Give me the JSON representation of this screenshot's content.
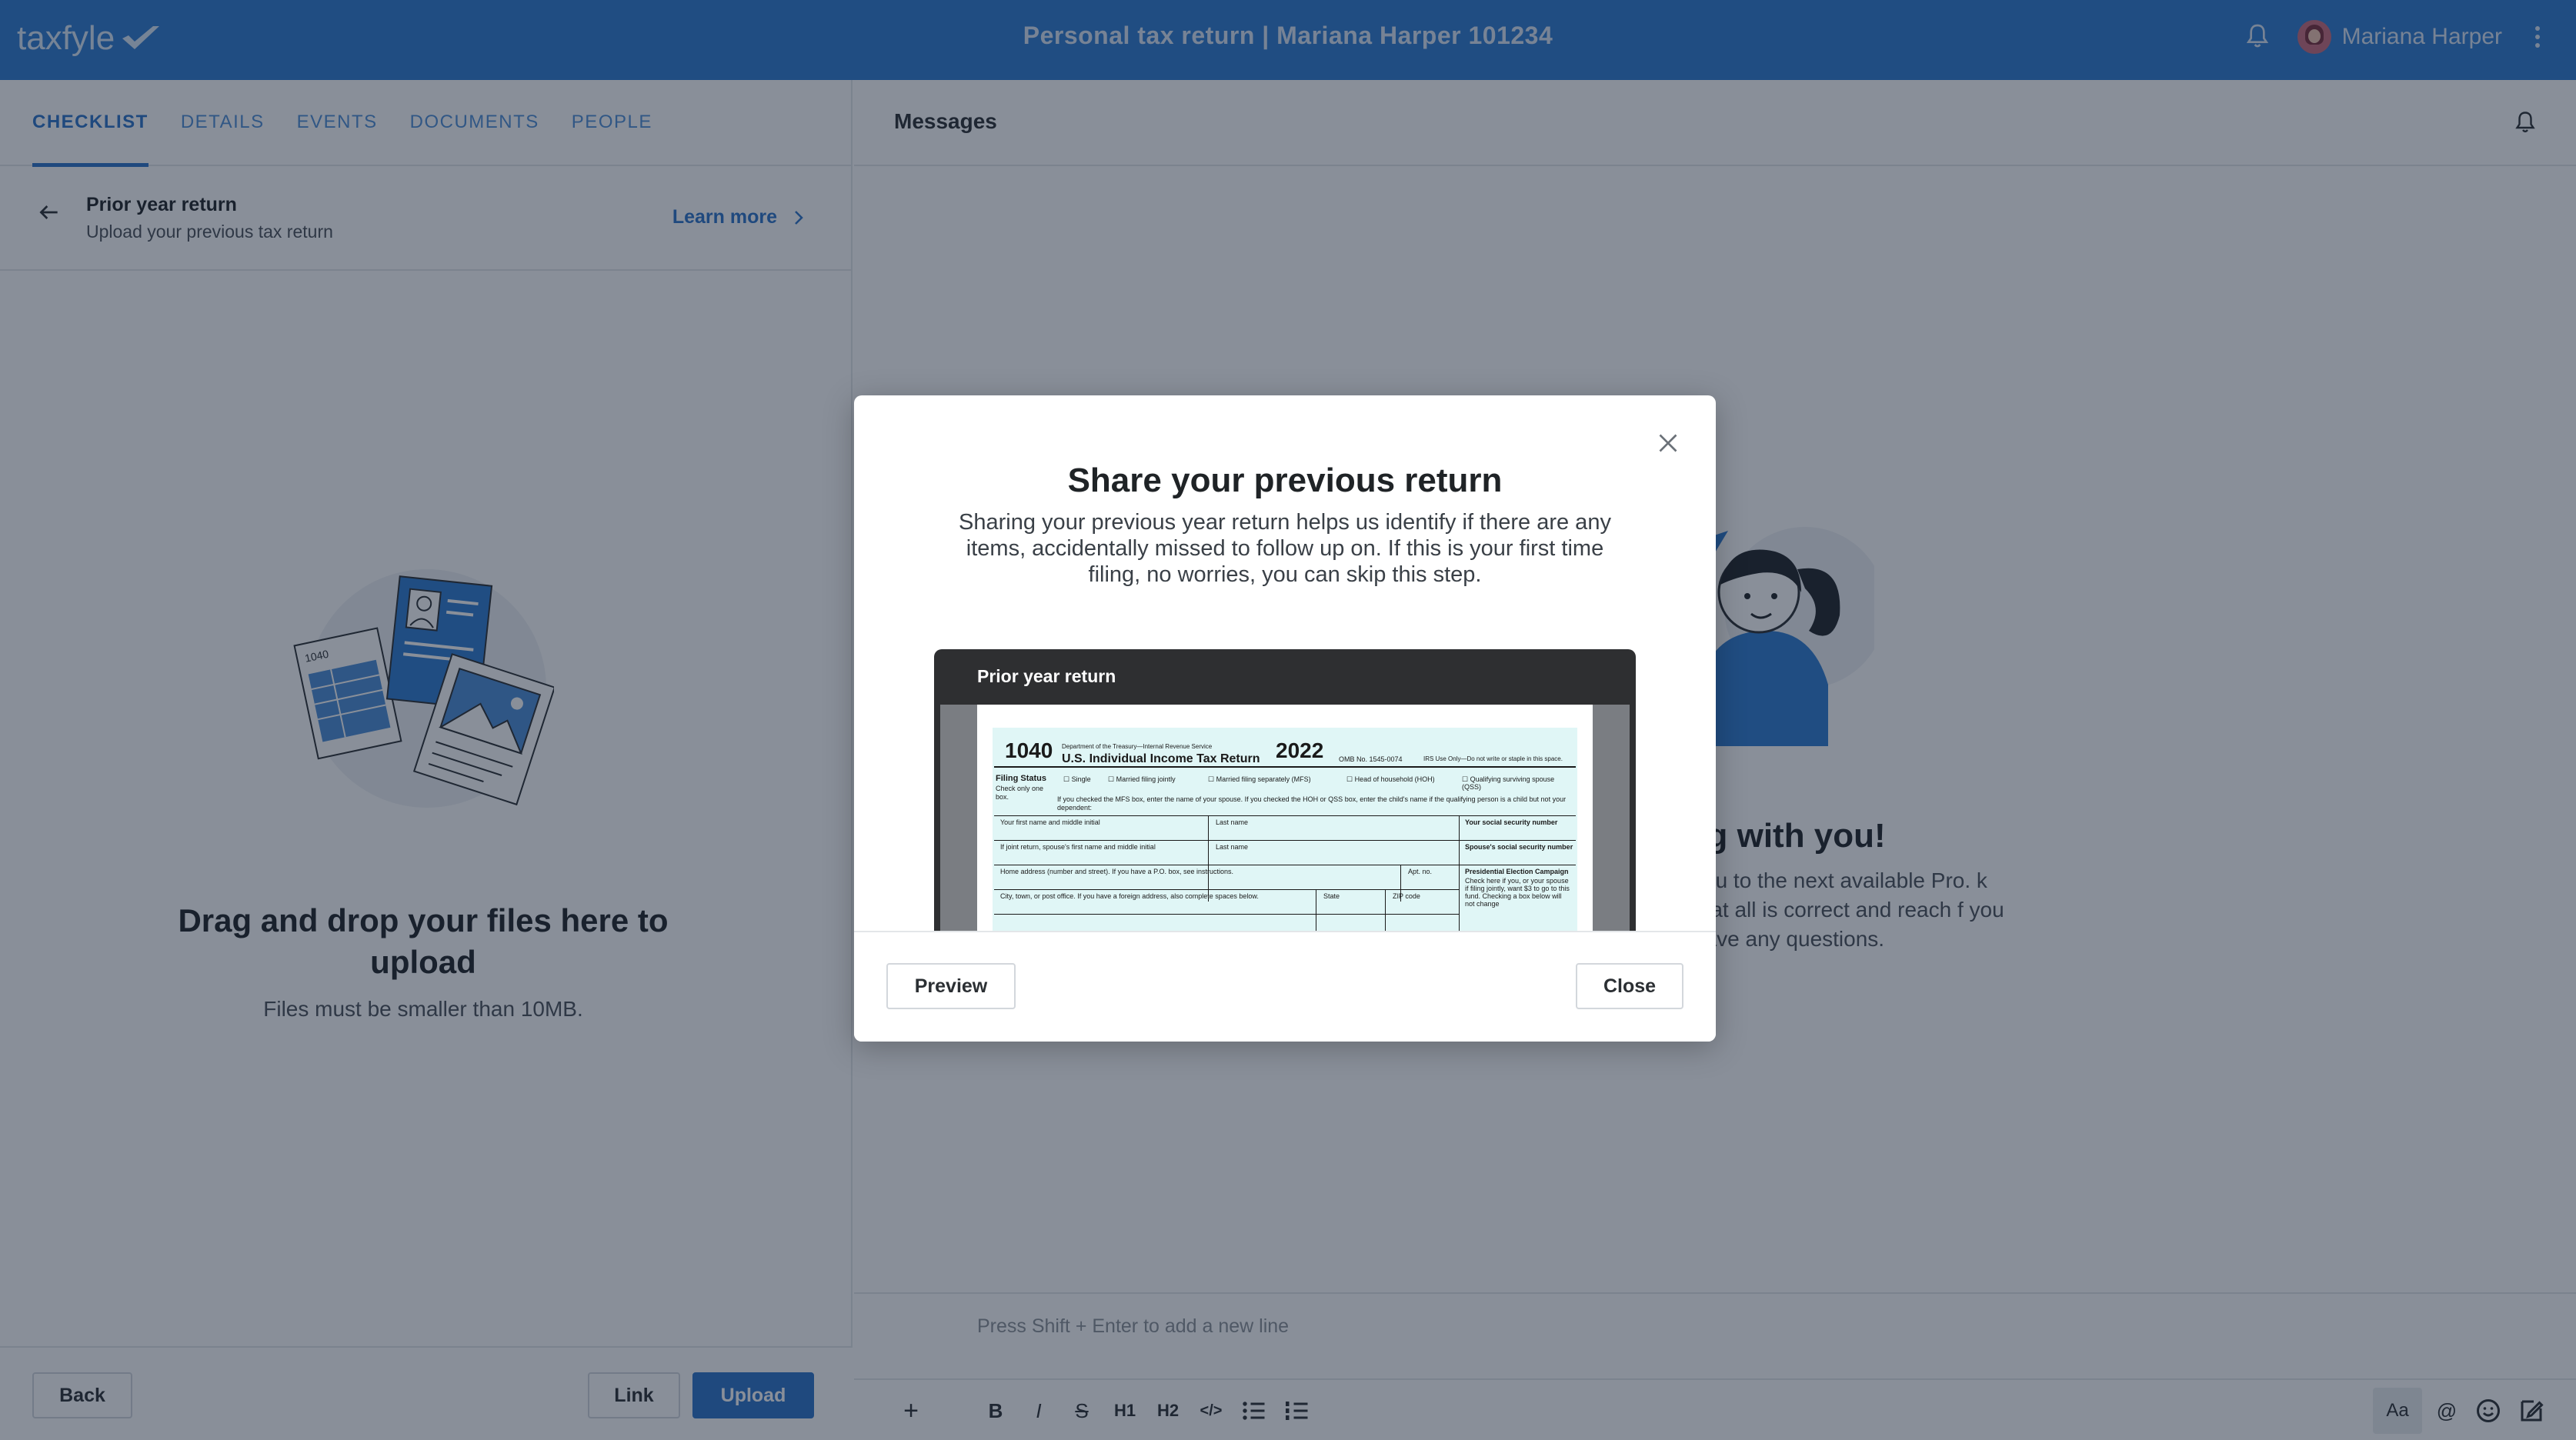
{
  "header": {
    "logo_text": "taxfyle",
    "title": "Personal tax return | Mariana Harper 101234",
    "user_name": "Mariana Harper"
  },
  "left": {
    "tabs": [
      {
        "label": "CHECKLIST",
        "active": true
      },
      {
        "label": "DETAILS",
        "active": false
      },
      {
        "label": "EVENTS",
        "active": false
      },
      {
        "label": "DOCUMENTS",
        "active": false
      },
      {
        "label": "PEOPLE",
        "active": false
      }
    ],
    "section": {
      "title": "Prior year return",
      "subtitle": "Upload your previous tax return",
      "learn_more": "Learn more"
    },
    "dropzone": {
      "title": "Drag and drop your files here to upload",
      "subtitle": "Files must be smaller than 10MB.",
      "doc_label": "1040"
    },
    "footer": {
      "back": "Back",
      "link": "Link",
      "upload": "Upload"
    }
  },
  "right": {
    "messages_title": "Messages",
    "welcome_title": "e working with you!",
    "welcome_body": "you to the next available Pro. k that all is correct and reach f you have any questions.",
    "composer_placeholder": "Press Shift + Enter to add a new line",
    "toolbar": {
      "add": "+",
      "bold": "B",
      "italic": "I",
      "strike": "S",
      "h1": "H1",
      "h2": "H2",
      "code": "</>",
      "text_style": "Aa",
      "mention": "@"
    }
  },
  "modal": {
    "title": "Share your previous return",
    "body": "Sharing your previous year return helps us identify if there are any items, accidentally missed to follow up on. If this is your first time filing, no worries, you can skip this step.",
    "preview_header": "Prior year return",
    "form": {
      "form_number": "1040",
      "agency": "Department of the Treasury—Internal Revenue Service",
      "form_title": "U.S. Individual Income Tax Return",
      "year": "2022",
      "omb": "OMB No. 1545-0074",
      "irs_use": "IRS Use Only—Do not write or staple in this space.",
      "filing_status": "Filing Status",
      "check_only": "Check only one box.",
      "options": [
        "Single",
        "Married filing jointly",
        "Married filing separately (MFS)",
        "Head of household (HOH)",
        "Qualifying surviving spouse (QSS)"
      ],
      "mfs_note": "If you checked the MFS box, enter the name of your spouse. If you checked the HOH or QSS box, enter the child's name if the qualifying person is a child but not your dependent:",
      "first_name": "Your first name and middle initial",
      "last_name": "Last name",
      "ssn": "Your social security number",
      "joint_first": "If joint return, spouse's first name and middle initial",
      "joint_last": "Last name",
      "spouse_ssn": "Spouse's social security number",
      "address": "Home address (number and street). If you have a P.O. box, see instructions.",
      "apt": "Apt. no.",
      "pec": "Presidential Election Campaign",
      "pec_note": "Check here if you, or your spouse if filing jointly, want $3 to go to this fund. Checking a box below will not change",
      "city": "City, town, or post office. If you have a foreign address, also complete spaces below.",
      "state": "State",
      "zip": "ZIP code"
    },
    "preview_button": "Preview",
    "close_button": "Close"
  }
}
